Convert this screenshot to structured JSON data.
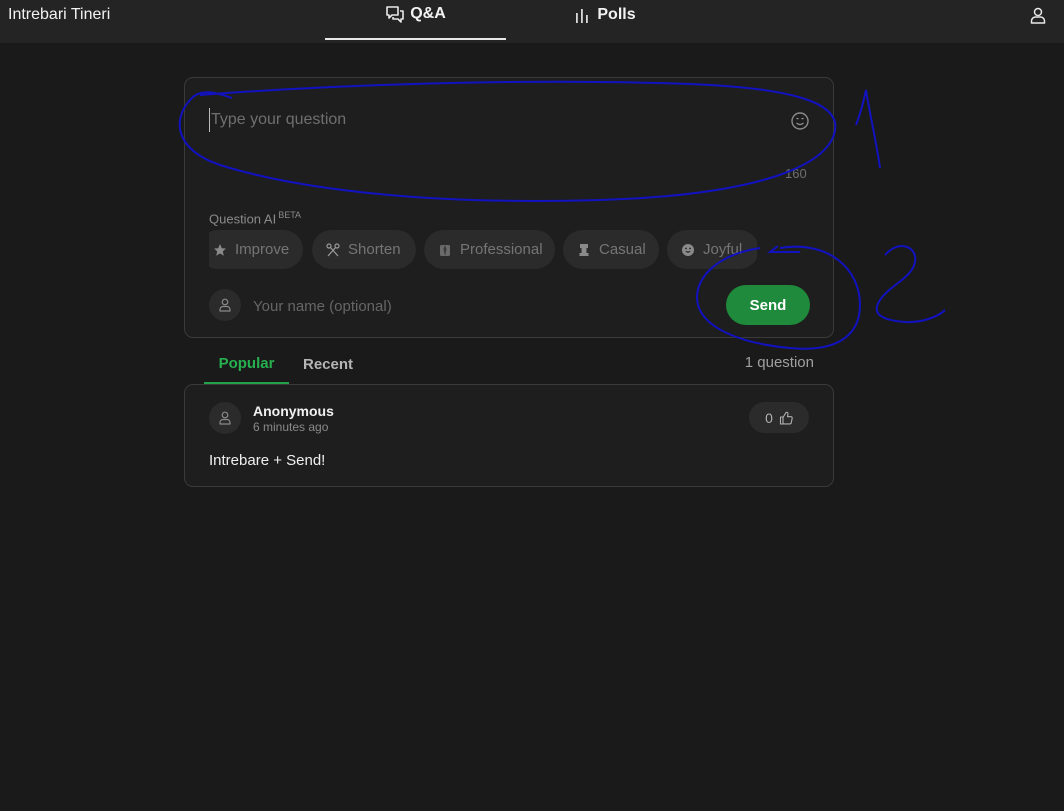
{
  "header": {
    "app_title": "Intrebari Tineri",
    "tabs": [
      {
        "label": "Q&A",
        "icon": "chat-bubbles-icon",
        "active": true
      },
      {
        "label": "Polls",
        "icon": "bar-chart-icon",
        "active": false
      }
    ],
    "user_icon": "user-icon"
  },
  "composer": {
    "question_placeholder": "Type your question",
    "question_value": "",
    "char_limit": "160",
    "emoji_icon": "smiley-icon",
    "ai_label": "Question AI",
    "ai_badge": "BETA",
    "ai_chips": [
      {
        "label": "Improve",
        "icon": "star-icon"
      },
      {
        "label": "Shorten",
        "icon": "scissors-icon"
      },
      {
        "label": "Professional",
        "icon": "suit-icon"
      },
      {
        "label": "Casual",
        "icon": "chess-pawn-icon"
      },
      {
        "label": "Joyful",
        "icon": "happy-face-icon"
      }
    ],
    "name_placeholder": "Your name (optional)",
    "name_value": "",
    "send_label": "Send"
  },
  "list": {
    "tabs": [
      {
        "label": "Popular",
        "active": true
      },
      {
        "label": "Recent",
        "active": false
      }
    ],
    "count_text": "1 question",
    "questions": [
      {
        "author": "Anonymous",
        "time": "6 minutes ago",
        "text": "Intrebare + Send!",
        "votes": "0"
      }
    ]
  },
  "colors": {
    "background": "#1a1a1a",
    "topbar": "#242424",
    "accent_green": "#1f8a3b",
    "annotation_blue": "#1010c8"
  }
}
